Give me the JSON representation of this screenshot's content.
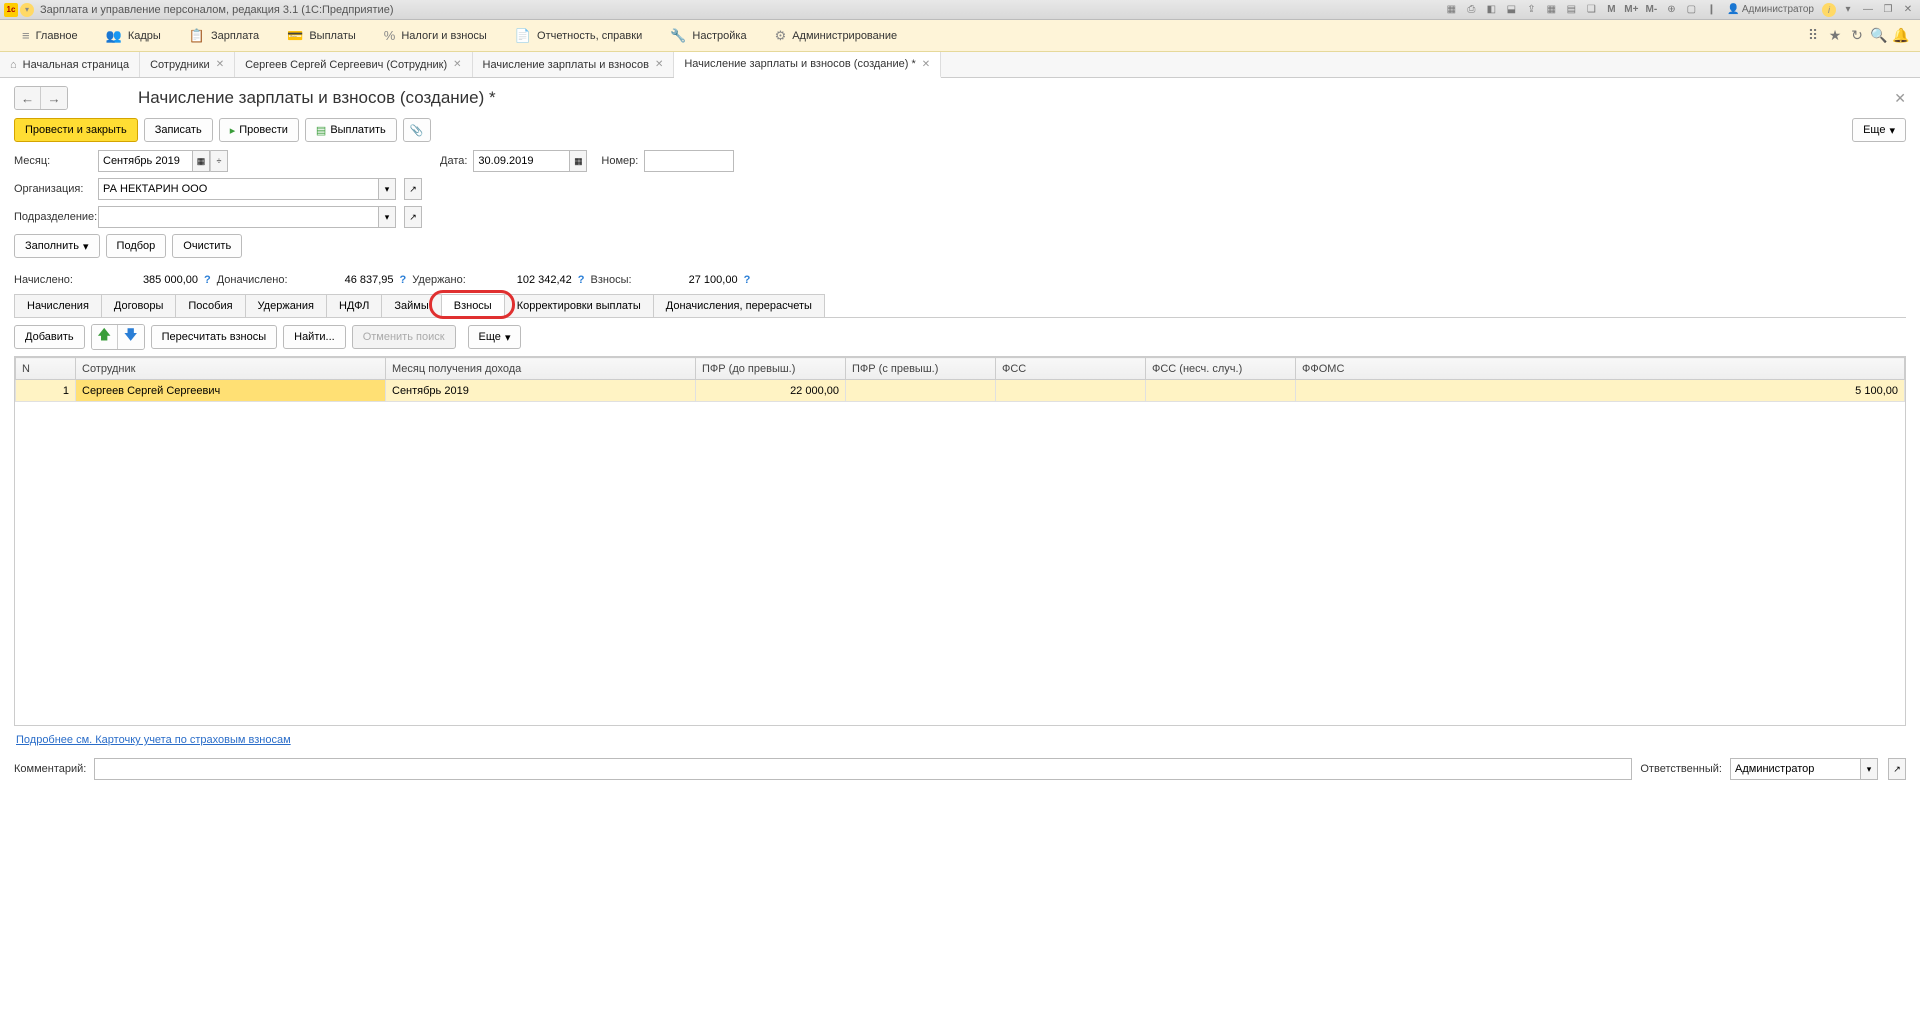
{
  "titlebar": {
    "title": "Зарплата и управление персоналом, редакция 3.1  (1С:Предприятие)",
    "user": "Администратор",
    "m_labels": [
      "M",
      "M+",
      "M-"
    ]
  },
  "mainmenu": [
    {
      "icon": "≡",
      "label": "Главное"
    },
    {
      "icon": "👥",
      "label": "Кадры"
    },
    {
      "icon": "📋",
      "label": "Зарплата"
    },
    {
      "icon": "💳",
      "label": "Выплаты"
    },
    {
      "icon": "%",
      "label": "Налоги и взносы"
    },
    {
      "icon": "📄",
      "label": "Отчетность, справки"
    },
    {
      "icon": "🔧",
      "label": "Настройка"
    },
    {
      "icon": "⚙",
      "label": "Администрирование"
    }
  ],
  "apptabs": [
    {
      "icon": "⌂",
      "label": "Начальная страница",
      "closable": false
    },
    {
      "label": "Сотрудники",
      "closable": true
    },
    {
      "label": "Сергеев Сергей Сергеевич (Сотрудник)",
      "closable": true
    },
    {
      "label": "Начисление зарплаты и взносов",
      "closable": true
    },
    {
      "label": "Начисление зарплаты и взносов (создание) *",
      "closable": true,
      "active": true
    }
  ],
  "page": {
    "title": "Начисление зарплаты и взносов (создание) *"
  },
  "cmd": {
    "post_close": "Провести и закрыть",
    "save": "Записать",
    "post": "Провести",
    "pay": "Выплатить",
    "more": "Еще"
  },
  "form": {
    "month_label": "Месяц:",
    "month_value": "Сентябрь 2019",
    "date_label": "Дата:",
    "date_value": "30.09.2019",
    "number_label": "Номер:",
    "number_value": "",
    "org_label": "Организация:",
    "org_value": "РА НЕКТАРИН ООО",
    "dept_label": "Подразделение:",
    "dept_value": "",
    "fill": "Заполнить",
    "pick": "Подбор",
    "clear": "Очистить"
  },
  "summary": {
    "accrued_label": "Начислено:",
    "accrued": "385 000,00",
    "addl_label": "Доначислено:",
    "addl": "46 837,95",
    "withheld_label": "Удержано:",
    "withheld": "102 342,42",
    "contrib_label": "Взносы:",
    "contrib": "27 100,00"
  },
  "datatabs": [
    "Начисления",
    "Договоры",
    "Пособия",
    "Удержания",
    "НДФЛ",
    "Займы",
    "Взносы",
    "Корректировки выплаты",
    "Доначисления, перерасчеты"
  ],
  "datatab_active": 6,
  "tbltoolbar": {
    "add": "Добавить",
    "recalc": "Пересчитать взносы",
    "find": "Найти...",
    "cancel": "Отменить поиск",
    "more": "Еще"
  },
  "columns": [
    "N",
    "Сотрудник",
    "Месяц получения дохода",
    "ПФР (до превыш.)",
    "ПФР (с превыш.)",
    "ФСС",
    "ФСС (несч. случ.)",
    "ФФОМС"
  ],
  "rows": [
    {
      "n": "1",
      "emp": "Сергеев Сергей Сергеевич",
      "month": "Сентябрь 2019",
      "pfr_below": "22 000,00",
      "pfr_above": "",
      "fss": "",
      "fss_acc": "",
      "ffoms": "5 100,00"
    }
  ],
  "footlink": "Подробнее см. Карточку учета по страховым взносам",
  "bottom": {
    "comment_label": "Комментарий:",
    "resp_label": "Ответственный:",
    "resp_value": "Администратор"
  }
}
